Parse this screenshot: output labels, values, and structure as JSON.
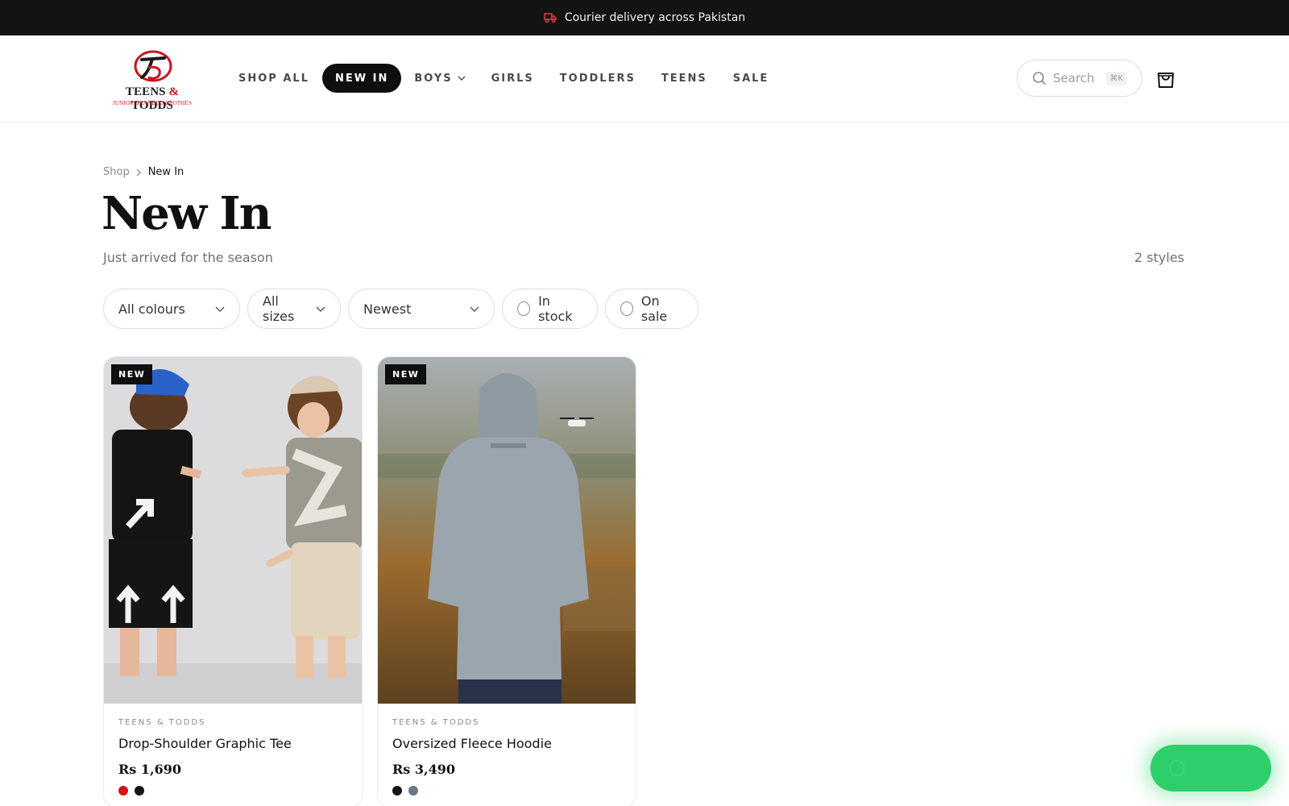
{
  "announcement": {
    "text": "Courier delivery across Pakistan",
    "icon": "truck-icon"
  },
  "brand": {
    "logo_name": "TEENS",
    "logo_amp": "&",
    "logo_name2": "TODDS",
    "logo_tagline": "JUNIOR BRANDED CLOTHES"
  },
  "nav": {
    "items": [
      {
        "label": "SHOP ALL",
        "active": false
      },
      {
        "label": "NEW IN",
        "active": true
      },
      {
        "label": "BOYS",
        "active": false,
        "dropdown": true
      },
      {
        "label": "GIRLS",
        "active": false
      },
      {
        "label": "TODDLERS",
        "active": false
      },
      {
        "label": "TEENS",
        "active": false
      },
      {
        "label": "SALE",
        "active": false
      }
    ]
  },
  "search": {
    "placeholder": "Search",
    "shortcut": "⌘K"
  },
  "breadcrumb": {
    "items": [
      "Shop",
      "New In"
    ]
  },
  "page": {
    "title": "New In",
    "subtitle": "Just arrived for the season",
    "count": "2 styles"
  },
  "filters": {
    "colour": "All colours",
    "size": "All sizes",
    "sort": "Newest",
    "in_stock": "In stock",
    "on_sale": "On sale"
  },
  "products": [
    {
      "badge": "NEW",
      "brand": "TEENS & TODDS",
      "name": "Drop-Shoulder Graphic Tee",
      "price": "Rs 1,690",
      "swatches": [
        "#d3141b",
        "#151515"
      ]
    },
    {
      "badge": "NEW",
      "brand": "TEENS & TODDS",
      "name": "Oversized Fleece Hoodie",
      "price": "Rs 3,490",
      "swatches": [
        "#151515",
        "#6c7686"
      ]
    }
  ],
  "colors": {
    "accent": "#0f0f0f",
    "brand_red": "#c8161d",
    "whatsapp": "#2ecf6b"
  }
}
